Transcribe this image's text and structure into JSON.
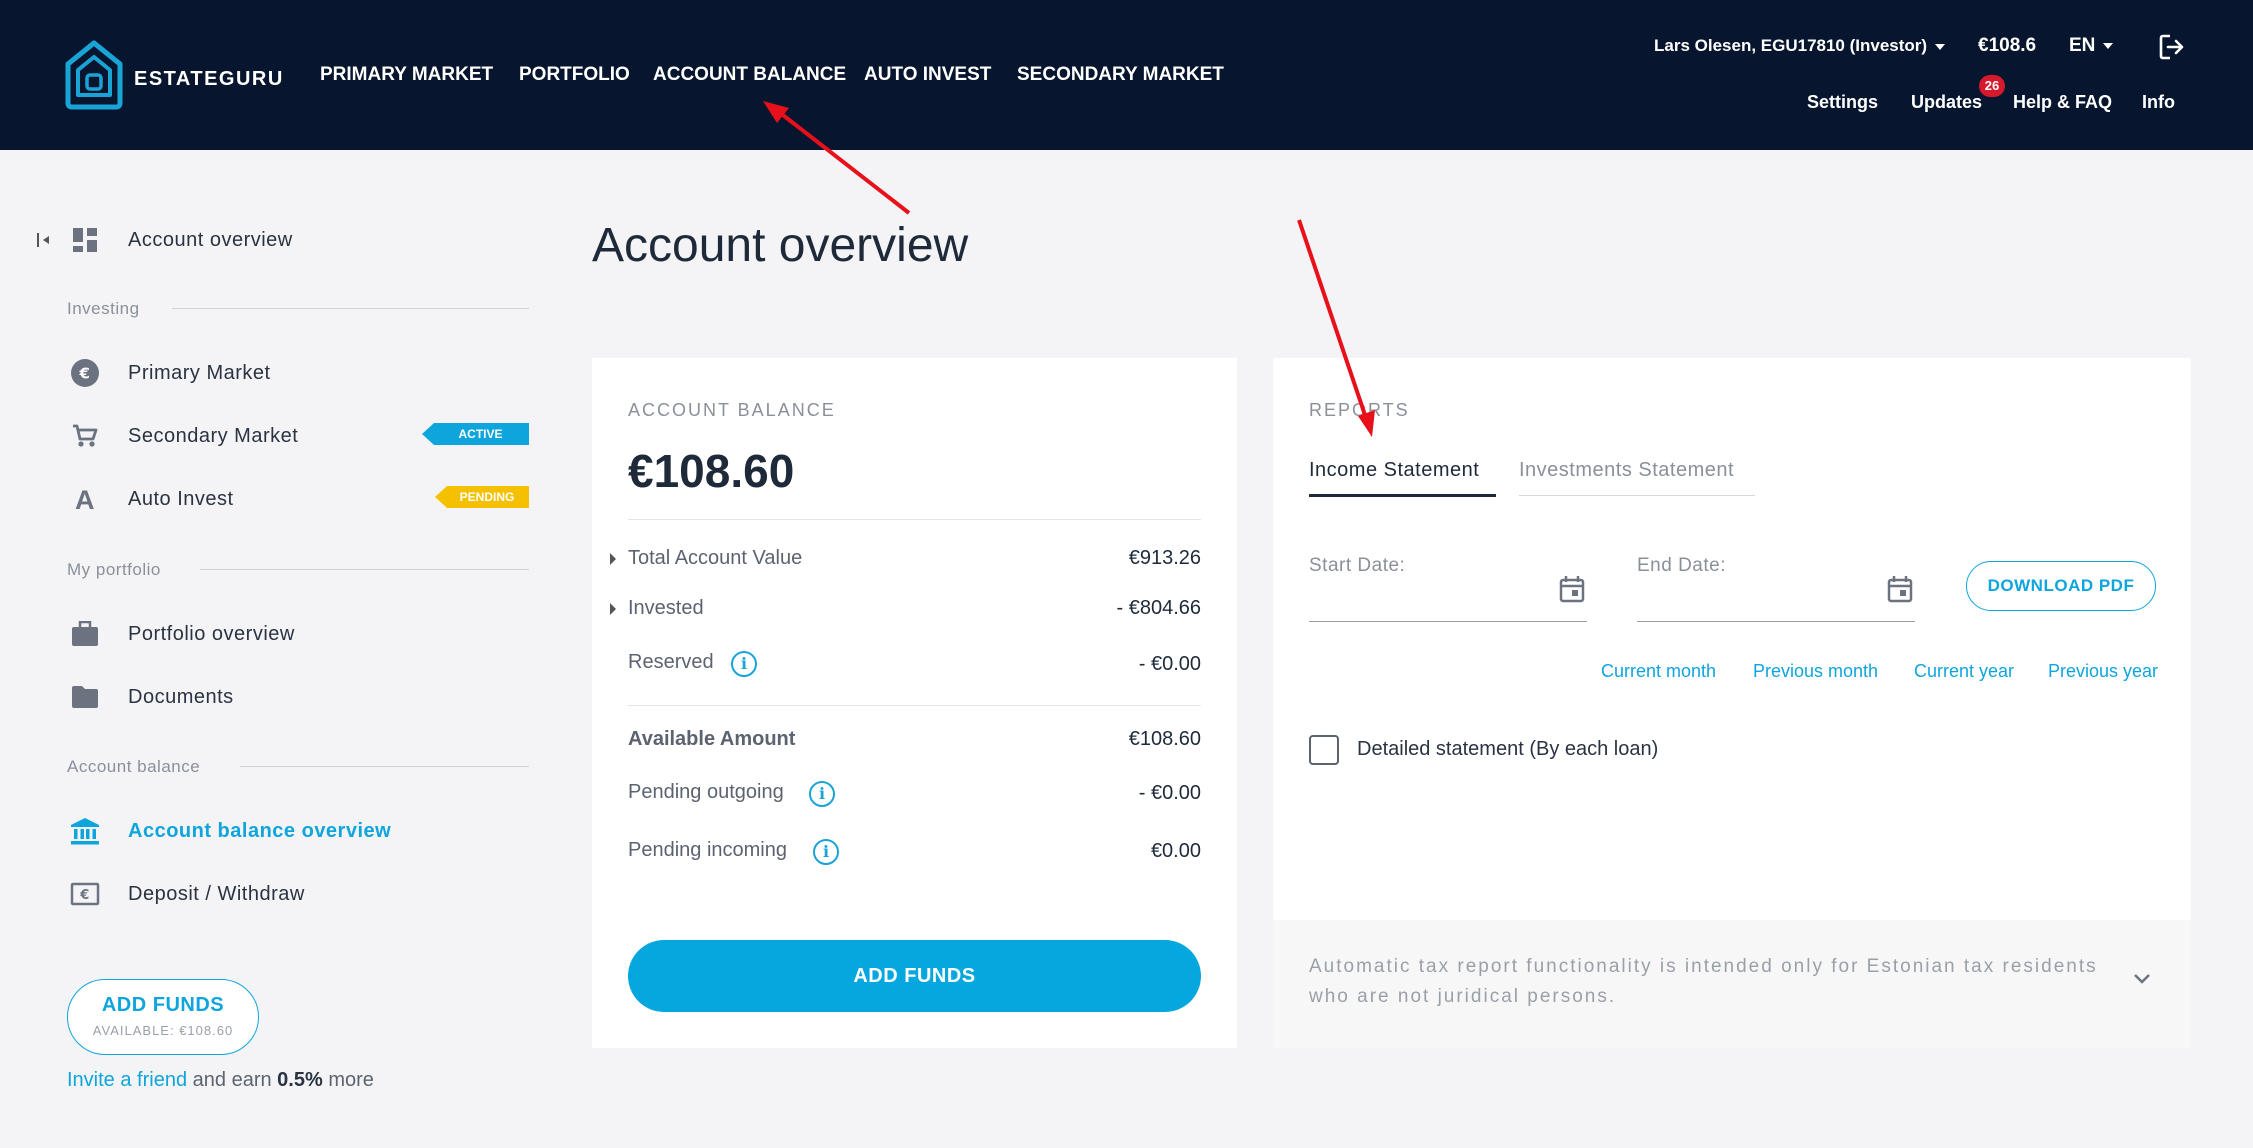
{
  "brand": {
    "name": "ESTATEGURU"
  },
  "nav": {
    "items": [
      {
        "label": "PRIMARY MARKET"
      },
      {
        "label": "PORTFOLIO"
      },
      {
        "label": "ACCOUNT BALANCE"
      },
      {
        "label": "AUTO INVEST"
      },
      {
        "label": "SECONDARY MARKET"
      }
    ]
  },
  "header": {
    "user": "Lars Olesen, EGU17810 (Investor)",
    "balance": "€108.6",
    "language": "EN",
    "links": {
      "settings": "Settings",
      "updates": "Updates",
      "updates_count": "26",
      "help": "Help & FAQ",
      "info": "Info"
    }
  },
  "sidebar": {
    "overview": "Account overview",
    "investing_title": "Investing",
    "primary_market": "Primary Market",
    "secondary_market": "Secondary Market",
    "secondary_tag": "ACTIVE",
    "auto_invest": "Auto Invest",
    "auto_tag": "PENDING",
    "portfolio_title": "My portfolio",
    "portfolio_overview": "Portfolio overview",
    "documents": "Documents",
    "balance_title": "Account balance",
    "balance_overview": "Account balance overview",
    "deposit": "Deposit / Withdraw",
    "add_funds": "ADD FUNDS",
    "available": "AVAILABLE: €108.60",
    "invite_link": "Invite a friend",
    "invite_mid": "and earn",
    "invite_rate": "0.5%",
    "invite_end": "more"
  },
  "main": {
    "title": "Account overview",
    "balance_card": {
      "heading": "ACCOUNT BALANCE",
      "amount": "€108.60",
      "rows": [
        {
          "label": "Total Account Value",
          "value": "€913.26"
        },
        {
          "label": "Invested",
          "value": "- €804.66"
        },
        {
          "label": "Reserved",
          "value": "- €0.00"
        },
        {
          "label": "Available Amount",
          "value": "€108.60"
        },
        {
          "label": "Pending outgoing",
          "value": "- €0.00"
        },
        {
          "label": "Pending incoming",
          "value": "€0.00"
        }
      ],
      "button": "ADD FUNDS"
    },
    "reports_card": {
      "heading": "REPORTS",
      "tabs": [
        {
          "label": "Income Statement"
        },
        {
          "label": "Investments Statement"
        }
      ],
      "start_label": "Start Date:",
      "end_label": "End Date:",
      "download": "DOWNLOAD PDF",
      "quick": [
        "Current month",
        "Previous month",
        "Current year",
        "Previous year"
      ],
      "checkbox": "Detailed statement (By each loan)",
      "tax_note": "Automatic tax report functionality is intended only for Estonian tax residents who are not juridical persons."
    }
  },
  "colors": {
    "header_bg": "#07162e",
    "accent": "#0ea5dd",
    "active_tag": "#0ea5dd",
    "pending_tag": "#f5c000",
    "badge": "#d7192d",
    "arrow": "#e8101a"
  }
}
